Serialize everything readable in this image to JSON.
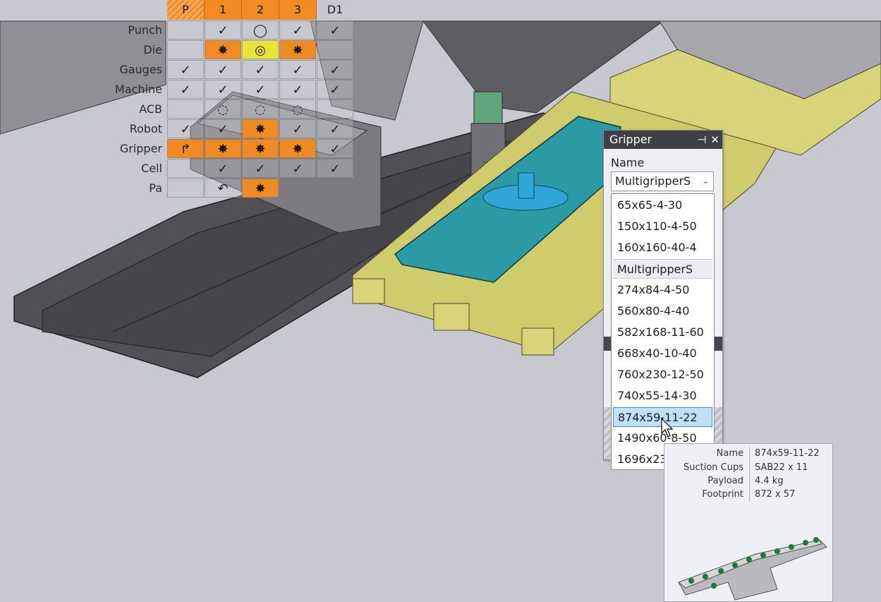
{
  "grid": {
    "columns": [
      "P",
      "1",
      "2",
      "3",
      "D1"
    ],
    "rows": [
      {
        "label": "Punch",
        "cells": [
          "",
          "✓",
          "◯",
          "✓",
          "✓"
        ]
      },
      {
        "label": "Die",
        "cells": [
          "",
          "✸",
          "◎",
          "✸",
          ""
        ]
      },
      {
        "label": "Gauges",
        "cells": [
          "✓",
          "✓",
          "✓",
          "✓",
          "✓"
        ]
      },
      {
        "label": "Machine",
        "cells": [
          "✓",
          "✓",
          "✓",
          "✓",
          "✓"
        ]
      },
      {
        "label": "ACB",
        "cells": [
          "",
          "◌",
          "◌",
          "◌",
          ""
        ]
      },
      {
        "label": "Robot",
        "cells": [
          "✓",
          "✓",
          "✸",
          "✓",
          "✓"
        ]
      },
      {
        "label": "Gripper",
        "cells": [
          "↱",
          "✸",
          "✸",
          "✸",
          "✓"
        ]
      },
      {
        "label": "Cell",
        "cells": [
          "",
          "✓",
          "✓",
          "✓",
          "✓"
        ]
      },
      {
        "label": "Pa",
        "cells": [
          "",
          "↶",
          "✸",
          "",
          ""
        ]
      }
    ]
  },
  "panel": {
    "title": "Gripper",
    "pin_icon": "pin-icon",
    "close_icon": "close-icon",
    "name_label": "Name",
    "combo_value": "MultigripperS"
  },
  "dropdown": {
    "items": [
      {
        "label": "65x65-4-30",
        "kind": "item"
      },
      {
        "label": "150x110-4-50",
        "kind": "item"
      },
      {
        "label": "160x160-40-4",
        "kind": "item"
      },
      {
        "label": "MultigripperS",
        "kind": "header"
      },
      {
        "label": "274x84-4-50",
        "kind": "item"
      },
      {
        "label": "560x80-4-40",
        "kind": "item"
      },
      {
        "label": "582x168-11-60",
        "kind": "item"
      },
      {
        "label": "668x40-10-40",
        "kind": "item"
      },
      {
        "label": "760x230-12-50",
        "kind": "item"
      },
      {
        "label": "740x55-14-30",
        "kind": "item"
      },
      {
        "label": "874x59-11-22",
        "kind": "selected"
      },
      {
        "label": "1490x60-8-50",
        "kind": "item"
      },
      {
        "label": "1696x23",
        "kind": "item"
      }
    ]
  },
  "tooltip": {
    "rows": [
      {
        "key": "Name",
        "value": "874x59-11-22"
      },
      {
        "key": "Suction Cups",
        "value": "SAB22 x 11"
      },
      {
        "key": "Payload",
        "value": "4.4 kg"
      },
      {
        "key": "Footprint",
        "value": "872 x 57"
      }
    ]
  },
  "colors": {
    "orange": "#f08a24",
    "yellow": "#e6e63a",
    "pallet": "#d7d47a",
    "sheet": "#2b9aa4",
    "machine": "#5a5a5e"
  }
}
